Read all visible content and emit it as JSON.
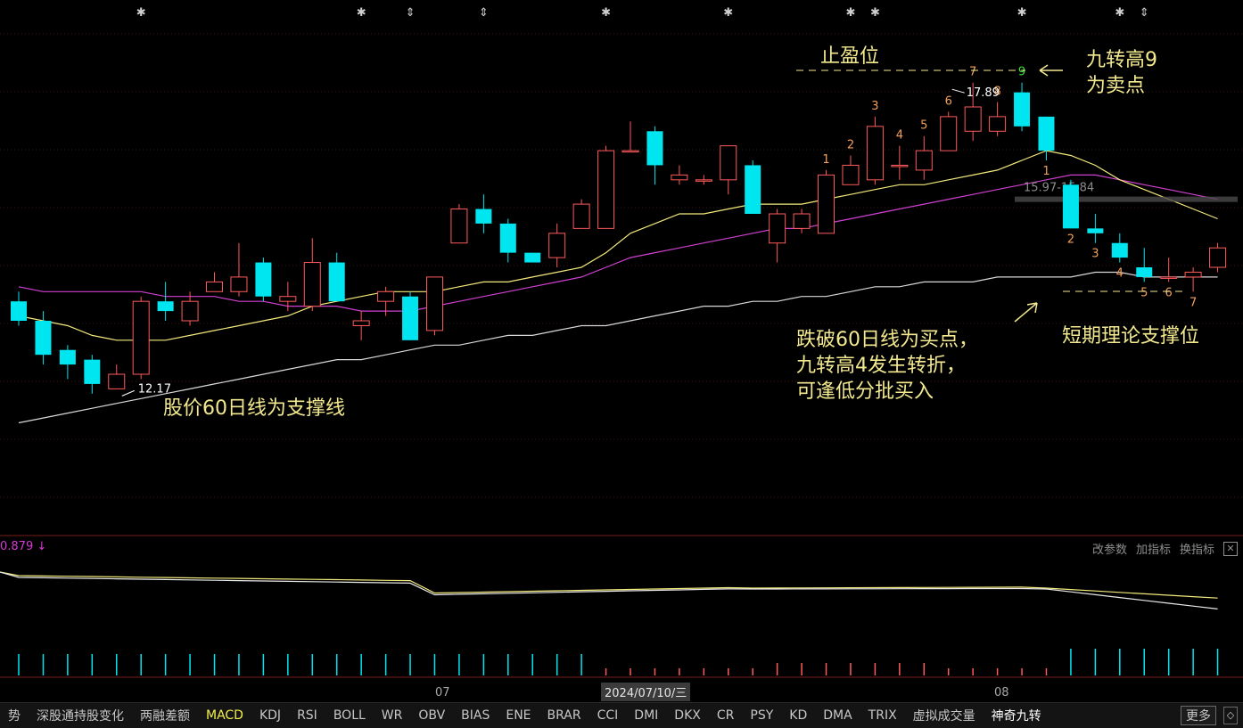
{
  "chart_data": {
    "type": "candlestick",
    "y_range": [
      9.0,
      20.0
    ],
    "price_marks": {
      "low": "12.17",
      "high": "17.89",
      "range_label": "15.97-15.84"
    },
    "candles": [
      [
        13.8,
        13.4,
        14.0,
        13.3
      ],
      [
        13.4,
        12.7,
        13.6,
        12.5
      ],
      [
        12.8,
        12.5,
        12.9,
        12.2
      ],
      [
        12.6,
        12.1,
        12.7,
        11.9
      ],
      [
        12.0,
        12.3,
        12.5,
        12.0
      ],
      [
        12.3,
        13.8,
        13.9,
        12.2
      ],
      [
        13.8,
        13.6,
        14.2,
        13.4
      ],
      [
        13.4,
        13.8,
        14.0,
        13.3
      ],
      [
        14.0,
        14.2,
        14.4,
        14.0
      ],
      [
        14.0,
        14.3,
        15.0,
        13.9
      ],
      [
        14.6,
        13.9,
        14.7,
        13.8
      ],
      [
        13.8,
        13.9,
        14.2,
        13.6
      ],
      [
        13.7,
        14.6,
        15.1,
        13.6
      ],
      [
        14.6,
        13.8,
        14.8,
        13.8
      ],
      [
        13.3,
        13.4,
        13.6,
        13.0
      ],
      [
        13.8,
        14.0,
        14.1,
        13.5
      ],
      [
        13.9,
        13.0,
        14.0,
        13.0
      ],
      [
        13.2,
        14.3,
        14.3,
        13.1
      ],
      [
        15.0,
        15.7,
        15.8,
        15.0
      ],
      [
        15.7,
        15.4,
        16.0,
        15.2
      ],
      [
        15.4,
        14.8,
        15.5,
        14.6
      ],
      [
        14.8,
        14.6,
        14.8,
        14.6
      ],
      [
        14.7,
        15.2,
        15.4,
        14.5
      ],
      [
        15.3,
        15.8,
        15.9,
        15.3
      ],
      [
        15.3,
        16.9,
        17.0,
        15.3
      ],
      [
        16.9,
        16.9,
        17.5,
        16.9
      ],
      [
        17.3,
        16.6,
        17.4,
        16.2
      ],
      [
        16.3,
        16.4,
        16.6,
        16.2
      ],
      [
        16.3,
        16.3,
        16.4,
        16.2
      ],
      [
        16.3,
        17.0,
        17.0,
        16.0
      ],
      [
        16.6,
        15.6,
        16.7,
        15.6
      ],
      [
        15.0,
        15.6,
        15.7,
        14.6
      ],
      [
        15.3,
        15.6,
        15.7,
        15.2
      ],
      [
        15.2,
        16.4,
        16.5,
        15.2
      ],
      [
        16.2,
        16.6,
        16.8,
        16.2
      ],
      [
        16.3,
        17.4,
        17.6,
        16.2
      ],
      [
        16.6,
        16.6,
        17.0,
        16.3
      ],
      [
        16.5,
        16.9,
        17.2,
        16.3
      ],
      [
        16.9,
        17.6,
        17.7,
        16.9
      ],
      [
        17.3,
        17.8,
        18.3,
        17.1
      ],
      [
        17.3,
        17.6,
        17.9,
        17.2
      ],
      [
        18.1,
        17.4,
        18.3,
        17.3
      ],
      [
        17.6,
        16.9,
        17.6,
        16.7
      ],
      [
        16.2,
        15.3,
        16.3,
        15.3
      ],
      [
        15.3,
        15.2,
        15.6,
        15.0
      ],
      [
        15.0,
        14.7,
        15.2,
        14.6
      ],
      [
        14.5,
        14.3,
        14.9,
        14.2
      ],
      [
        14.3,
        14.3,
        14.7,
        14.2
      ],
      [
        14.3,
        14.4,
        14.5,
        14.0
      ],
      [
        14.5,
        14.9,
        15.0,
        14.4
      ]
    ],
    "ma_line": [
      13.5,
      13.4,
      13.3,
      13.1,
      13.0,
      13.0,
      13.0,
      13.1,
      13.2,
      13.3,
      13.4,
      13.5,
      13.7,
      13.8,
      13.9,
      14.0,
      14.0,
      14.0,
      14.1,
      14.2,
      14.2,
      14.3,
      14.4,
      14.5,
      14.8,
      15.2,
      15.4,
      15.6,
      15.6,
      15.7,
      15.8,
      15.8,
      15.8,
      15.9,
      16.0,
      16.1,
      16.2,
      16.2,
      16.3,
      16.4,
      16.5,
      16.7,
      16.9,
      16.8,
      16.6,
      16.3,
      16.1,
      15.9,
      15.7,
      15.5
    ],
    "ma_line_2": [
      14.1,
      14.0,
      14.0,
      14.0,
      14.0,
      14.0,
      13.9,
      13.9,
      13.9,
      13.8,
      13.8,
      13.7,
      13.7,
      13.7,
      13.6,
      13.6,
      13.6,
      13.7,
      13.8,
      13.9,
      14.0,
      14.1,
      14.2,
      14.3,
      14.5,
      14.7,
      14.8,
      14.9,
      15.0,
      15.1,
      15.2,
      15.3,
      15.3,
      15.4,
      15.5,
      15.6,
      15.7,
      15.8,
      15.9,
      16.0,
      16.1,
      16.2,
      16.3,
      16.4,
      16.4,
      16.3,
      16.2,
      16.1,
      16.0,
      15.9
    ],
    "ma_line_3": [
      11.3,
      11.4,
      11.5,
      11.6,
      11.7,
      11.8,
      11.9,
      12.0,
      12.1,
      12.2,
      12.3,
      12.4,
      12.5,
      12.6,
      12.6,
      12.7,
      12.8,
      12.9,
      12.9,
      13.0,
      13.1,
      13.1,
      13.2,
      13.3,
      13.3,
      13.4,
      13.5,
      13.6,
      13.7,
      13.7,
      13.8,
      13.8,
      13.9,
      13.9,
      14.0,
      14.1,
      14.1,
      14.2,
      14.2,
      14.2,
      14.3,
      14.3,
      14.3,
      14.3,
      14.4,
      14.4,
      14.3,
      14.3,
      14.3,
      14.3
    ],
    "nine_turn_counts": [
      {
        "candle": 33,
        "label": "1",
        "pos": "above",
        "color": "#f0a05a"
      },
      {
        "candle": 34,
        "label": "2",
        "pos": "above",
        "color": "#f0a05a"
      },
      {
        "candle": 35,
        "label": "3",
        "pos": "above",
        "color": "#f0a05a"
      },
      {
        "candle": 36,
        "label": "4",
        "pos": "above",
        "color": "#f0a05a"
      },
      {
        "candle": 37,
        "label": "5",
        "pos": "above",
        "color": "#f0a05a"
      },
      {
        "candle": 38,
        "label": "6",
        "pos": "above",
        "color": "#f0a05a"
      },
      {
        "candle": 39,
        "label": "7",
        "pos": "above",
        "color": "#f0a05a"
      },
      {
        "candle": 40,
        "label": "8",
        "pos": "above",
        "color": "#f0a05a"
      },
      {
        "candle": 41,
        "label": "9",
        "pos": "above",
        "color": "#39e83a"
      },
      {
        "candle": 42,
        "label": "1",
        "pos": "below",
        "color": "#f0a05a"
      },
      {
        "candle": 43,
        "label": "2",
        "pos": "below",
        "color": "#f0a05a"
      },
      {
        "candle": 44,
        "label": "3",
        "pos": "below",
        "color": "#f0a05a"
      },
      {
        "candle": 45,
        "label": "4",
        "pos": "below",
        "color": "#f0a05a"
      },
      {
        "candle": 46,
        "label": "5",
        "pos": "below",
        "color": "#f0a05a"
      },
      {
        "candle": 47,
        "label": "6",
        "pos": "below",
        "color": "#f0a05a"
      },
      {
        "candle": 48,
        "label": "7",
        "pos": "below",
        "color": "#f0a05a"
      }
    ],
    "top_markers": [
      {
        "candle": 5,
        "symbol": "✱"
      },
      {
        "candle": 14,
        "symbol": "✱"
      },
      {
        "candle": 16,
        "symbol": "⇕"
      },
      {
        "candle": 19,
        "symbol": "⇕"
      },
      {
        "candle": 24,
        "symbol": "✱"
      },
      {
        "candle": 29,
        "symbol": "✱"
      },
      {
        "candle": 34,
        "symbol": "✱"
      },
      {
        "candle": 35,
        "symbol": "✱"
      },
      {
        "candle": 41,
        "symbol": "✱"
      },
      {
        "candle": 45,
        "symbol": "✱"
      },
      {
        "candle": 46,
        "symbol": "⇕"
      }
    ],
    "indicator": {
      "value_label": "0.879 ↓"
    },
    "x_ticks": [
      {
        "candle": 18,
        "label": "07"
      },
      {
        "candle": 41,
        "label": "08"
      }
    ],
    "cursor_date": "2024/07/10/三"
  },
  "annotations": {
    "take_profit": "止盈位",
    "sell_line1": "九转高9",
    "sell_line2": "为卖点",
    "buy_line1": "跌破60日线为买点，",
    "buy_line2": "九转高4发生转折，",
    "buy_line3": "可逢低分批买入",
    "support_short": "短期理论支撑位",
    "support_60": "股价60日线为支撑线"
  },
  "colors": {
    "up": "#ff5a5a",
    "down": "#00e6f0",
    "ma1": "#f3e97a",
    "ma2": "#d040d0",
    "ma3": "#d8d8d8",
    "annotation": "#f3e98f"
  },
  "toolbar": {
    "params": "改参数",
    "add": "加指标",
    "swap": "换指标",
    "close": "✕"
  },
  "tabs": [
    "势",
    "深股通持股变化",
    "两融差额",
    "MACD",
    "KDJ",
    "RSI",
    "BOLL",
    "WR",
    "OBV",
    "BIAS",
    "ENE",
    "BRAR",
    "CCI",
    "DMI",
    "DKX",
    "CR",
    "PSY",
    "KD",
    "DMA",
    "TRIX",
    "虚拟成交量",
    "神奇九转"
  ],
  "active_tab": "MACD",
  "more_label": "更多",
  "scroll_label": "◇"
}
